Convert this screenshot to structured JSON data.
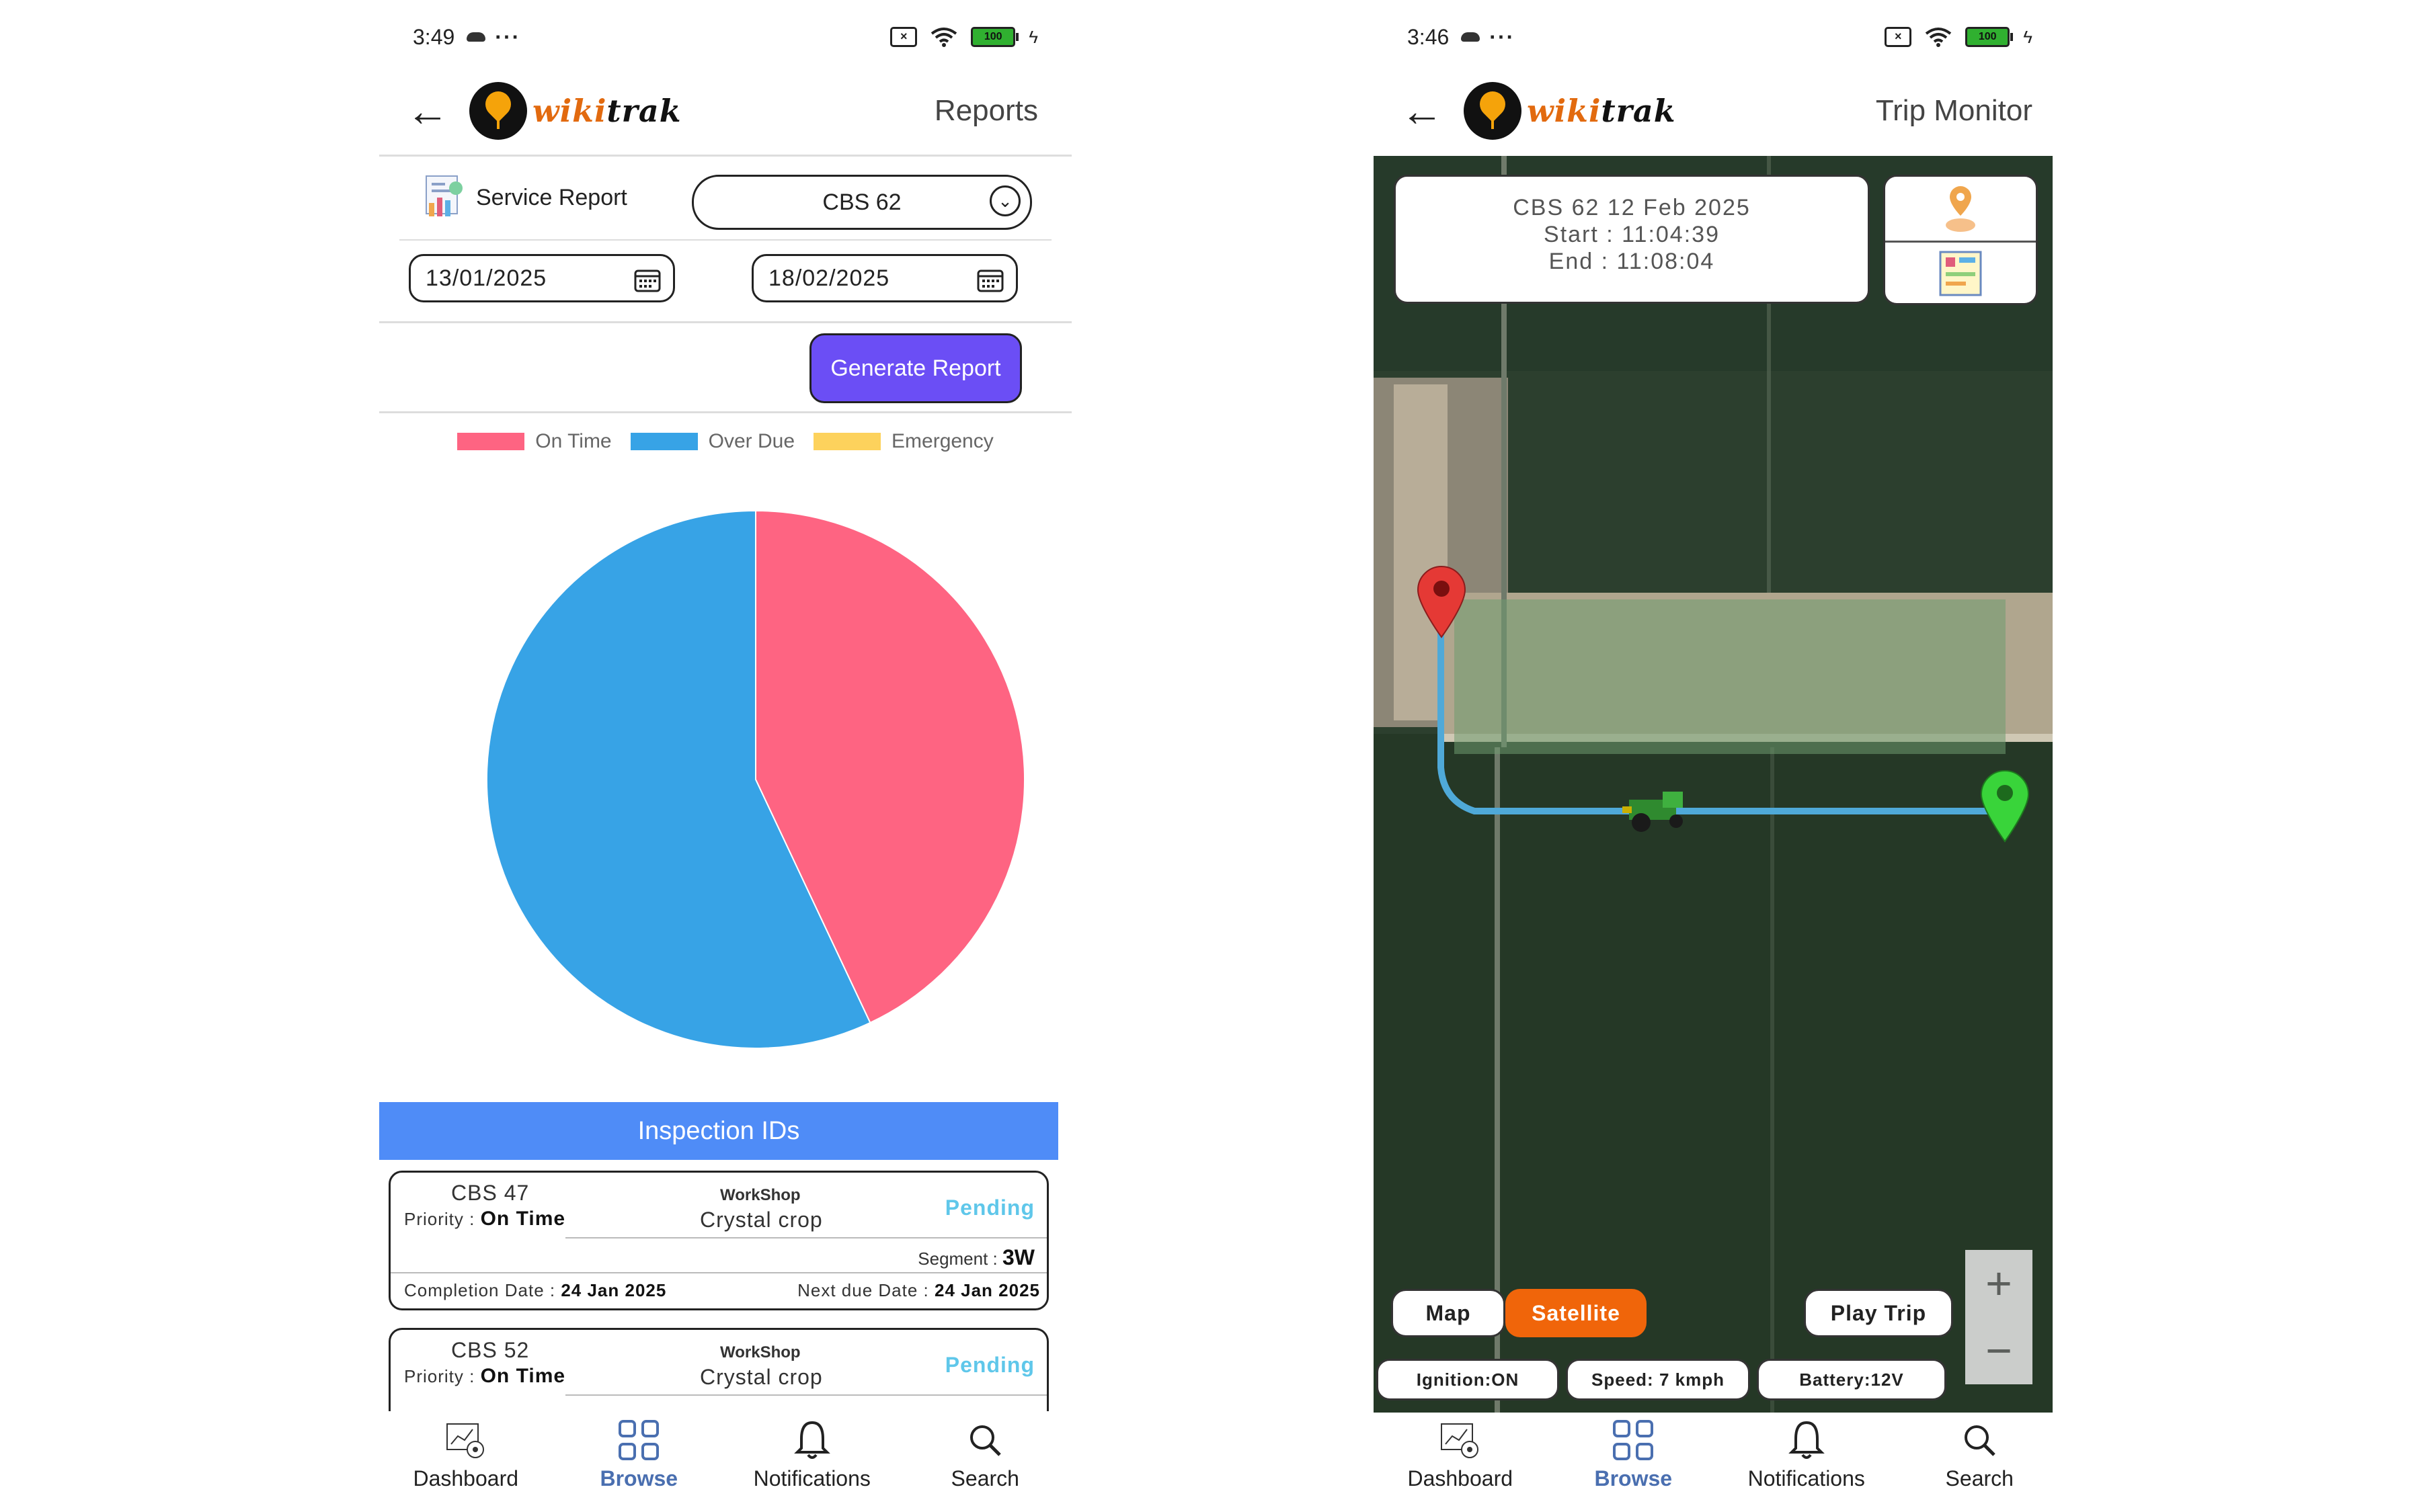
{
  "status_left": {
    "time": "3:49",
    "battery": "100"
  },
  "status_right": {
    "time": "3:46",
    "battery": "100"
  },
  "brand": {
    "wiki": "wiki",
    "trak": "trak"
  },
  "reports": {
    "title": "Reports",
    "service_report_label": "Service Report",
    "vehicle_selected": "CBS 62",
    "from_date": "13/01/2025",
    "to_date": "18/02/2025",
    "generate_label": "Generate Report",
    "inspection_header": "Inspection IDs",
    "cards": [
      {
        "id": "CBS 47",
        "priority_label": "Priority : ",
        "priority": "On Time",
        "workshop_label": "WorkShop",
        "workshop": "Crystal crop",
        "status": "Pending",
        "segment_label": "Segment : ",
        "segment": "3W",
        "completion_label": "Completion Date : ",
        "completion": "24 Jan 2025",
        "next_label": "Next due Date : ",
        "next": "24 Jan 2025"
      },
      {
        "id": "CBS 52",
        "priority_label": "Priority : ",
        "priority": "On Time",
        "workshop_label": "WorkShop",
        "workshop": "Crystal crop",
        "status": "Pending"
      }
    ]
  },
  "chart_data": {
    "type": "pie",
    "series": [
      {
        "name": "On Time",
        "value": 43,
        "color": "#fe6482"
      },
      {
        "name": "Over Due",
        "value": 57,
        "color": "#37a3e6"
      },
      {
        "name": "Emergency",
        "value": 0,
        "color": "#fdd25c"
      }
    ],
    "legend_position": "top"
  },
  "trip": {
    "title": "Trip Monitor",
    "line1": "CBS 62 12 Feb 2025",
    "line2": "Start : 11:04:39",
    "line3": "End : 11:08:04",
    "map_label": "Map",
    "satellite_label": "Satellite",
    "play_label": "Play Trip",
    "ignition": "Ignition:ON",
    "speed": "Speed: 7 kmph",
    "battery": "Battery:12V",
    "zoom_in": "+",
    "zoom_out": "−"
  },
  "nav": {
    "dashboard": "Dashboard",
    "browse": "Browse",
    "notifications": "Notifications",
    "search": "Search"
  },
  "colors": {
    "accent_purple": "#6b4ef5",
    "header_blue": "#4f8cf7",
    "satellite_orange": "#f0650a",
    "pending": "#5fc7ea",
    "route": "#4fa9d8"
  }
}
